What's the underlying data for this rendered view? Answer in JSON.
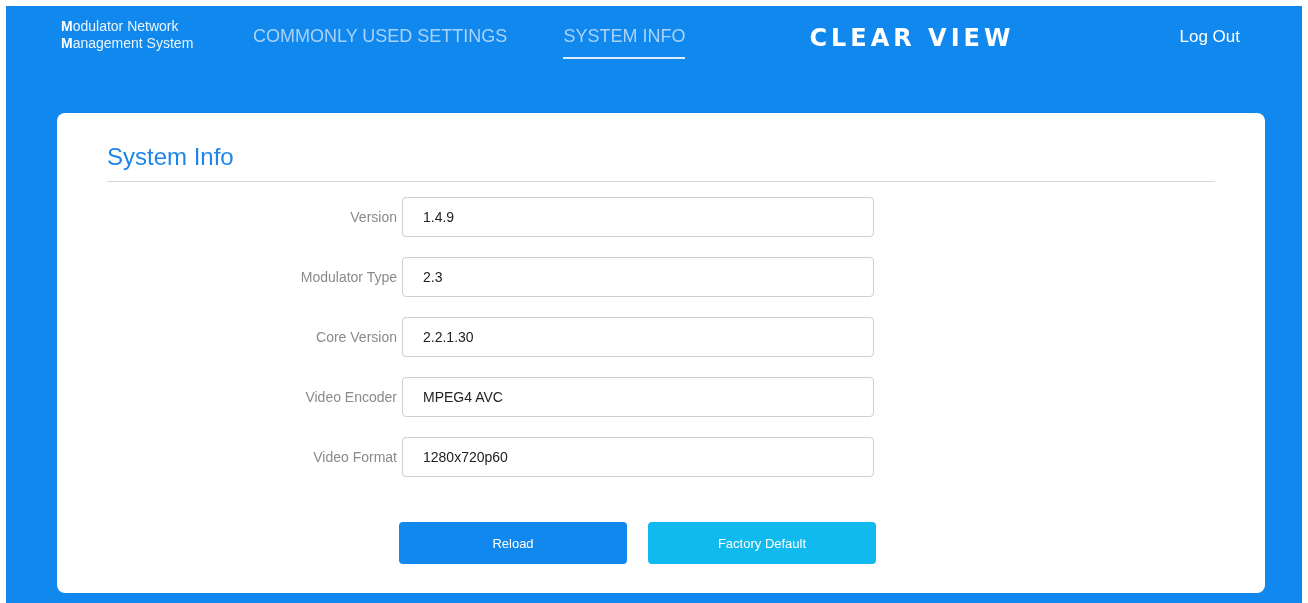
{
  "header": {
    "brand": [
      "**M**odulator Network",
      "**M**anagement System"
    ],
    "nav": [
      {
        "label": "COMMONLY USED SETTINGS",
        "selected": false
      },
      {
        "label": "SYSTEM INFO",
        "selected": true
      }
    ],
    "logo": "CLEAR VIEW",
    "logout": "Log Out"
  },
  "card": {
    "title": "System Info",
    "fields": [
      {
        "label": "Version",
        "value": "1.4.9"
      },
      {
        "label": "Modulator Type",
        "value": "2.3"
      },
      {
        "label": "Core Version",
        "value": "2.2.1.30"
      },
      {
        "label": "Video Encoder",
        "value": "MPEG4 AVC"
      },
      {
        "label": "Video Format",
        "value": "1280x720p60"
      }
    ],
    "buttons": [
      {
        "label": "Reload",
        "kind": "primary"
      },
      {
        "label": "Factory Default",
        "kind": "secondary"
      }
    ]
  }
}
